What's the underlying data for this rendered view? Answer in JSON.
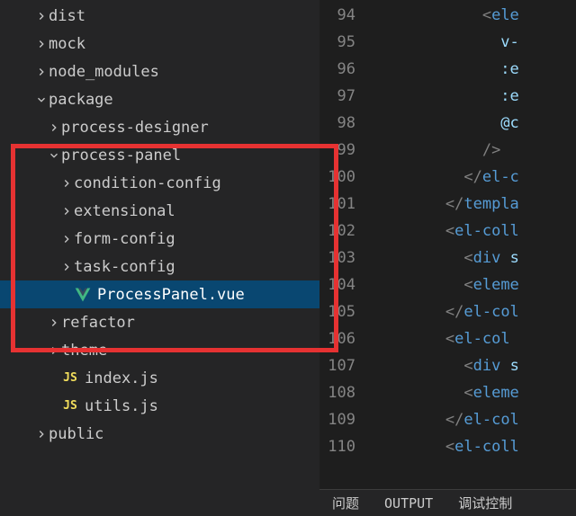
{
  "tree": [
    {
      "indent": 1,
      "chevron": "right",
      "icon": null,
      "label": "dist"
    },
    {
      "indent": 1,
      "chevron": "right",
      "icon": null,
      "label": "mock"
    },
    {
      "indent": 1,
      "chevron": "right",
      "icon": null,
      "label": "node_modules"
    },
    {
      "indent": 1,
      "chevron": "down",
      "icon": null,
      "label": "package"
    },
    {
      "indent": 2,
      "chevron": "right",
      "icon": null,
      "label": "process-designer"
    },
    {
      "indent": 2,
      "chevron": "down",
      "icon": null,
      "label": "process-panel"
    },
    {
      "indent": 3,
      "chevron": "right",
      "icon": null,
      "label": "condition-config"
    },
    {
      "indent": 3,
      "chevron": "right",
      "icon": null,
      "label": "extensional"
    },
    {
      "indent": 3,
      "chevron": "right",
      "icon": null,
      "label": "form-config"
    },
    {
      "indent": 3,
      "chevron": "right",
      "icon": null,
      "label": "task-config"
    },
    {
      "indent": 3,
      "chevron": null,
      "icon": "vue",
      "label": "ProcessPanel.vue",
      "selected": true
    },
    {
      "indent": 2,
      "chevron": "right",
      "icon": null,
      "label": "refactor"
    },
    {
      "indent": 2,
      "chevron": "right",
      "icon": null,
      "label": "theme"
    },
    {
      "indent": 2,
      "chevron": null,
      "icon": "js",
      "label": "index.js"
    },
    {
      "indent": 2,
      "chevron": null,
      "icon": "js",
      "label": "utils.js"
    },
    {
      "indent": 1,
      "chevron": "right",
      "icon": null,
      "label": "public"
    }
  ],
  "lines": [
    {
      "num": "94",
      "html": "            <span class='bracket'>&lt;</span><span class='tag'>ele</span>"
    },
    {
      "num": "95",
      "html": "              <span class='attr'>v-</span>"
    },
    {
      "num": "96",
      "html": "              <span class='attr'>:e</span>"
    },
    {
      "num": "97",
      "html": "              <span class='attr'>:e</span>"
    },
    {
      "num": "98",
      "html": "              <span class='attr'>@c</span>"
    },
    {
      "num": "99",
      "html": "            <span class='bracket'>/&gt;</span>"
    },
    {
      "num": "100",
      "html": "          <span class='bracket'>&lt;/</span><span class='tag'>el-c</span>"
    },
    {
      "num": "101",
      "html": "        <span class='bracket'>&lt;/</span><span class='tag'>templa</span>"
    },
    {
      "num": "102",
      "html": "        <span class='bracket'>&lt;</span><span class='tag'>el-coll</span>"
    },
    {
      "num": "103",
      "html": "          <span class='bracket'>&lt;</span><span class='tag'>div</span> <span class='attr'>s</span>"
    },
    {
      "num": "104",
      "html": "          <span class='bracket'>&lt;</span><span class='tag'>eleme</span>"
    },
    {
      "num": "105",
      "html": "        <span class='bracket'>&lt;/</span><span class='tag'>el-col</span>"
    },
    {
      "num": "106",
      "html": "        <span class='bracket'>&lt;</span><span class='tag'>el-col</span>"
    },
    {
      "num": "107",
      "html": "          <span class='bracket'>&lt;</span><span class='tag'>div</span> <span class='attr'>s</span>"
    },
    {
      "num": "108",
      "html": "          <span class='bracket'>&lt;</span><span class='tag'>eleme</span>"
    },
    {
      "num": "109",
      "html": "        <span class='bracket'>&lt;/</span><span class='tag'>el-col</span>"
    },
    {
      "num": "110",
      "html": "        <span class='bracket'>&lt;</span><span class='tag'>el-coll</span>"
    }
  ],
  "statusbar": {
    "problems": "问题",
    "output": "OUTPUT",
    "debug": "调试控制"
  }
}
